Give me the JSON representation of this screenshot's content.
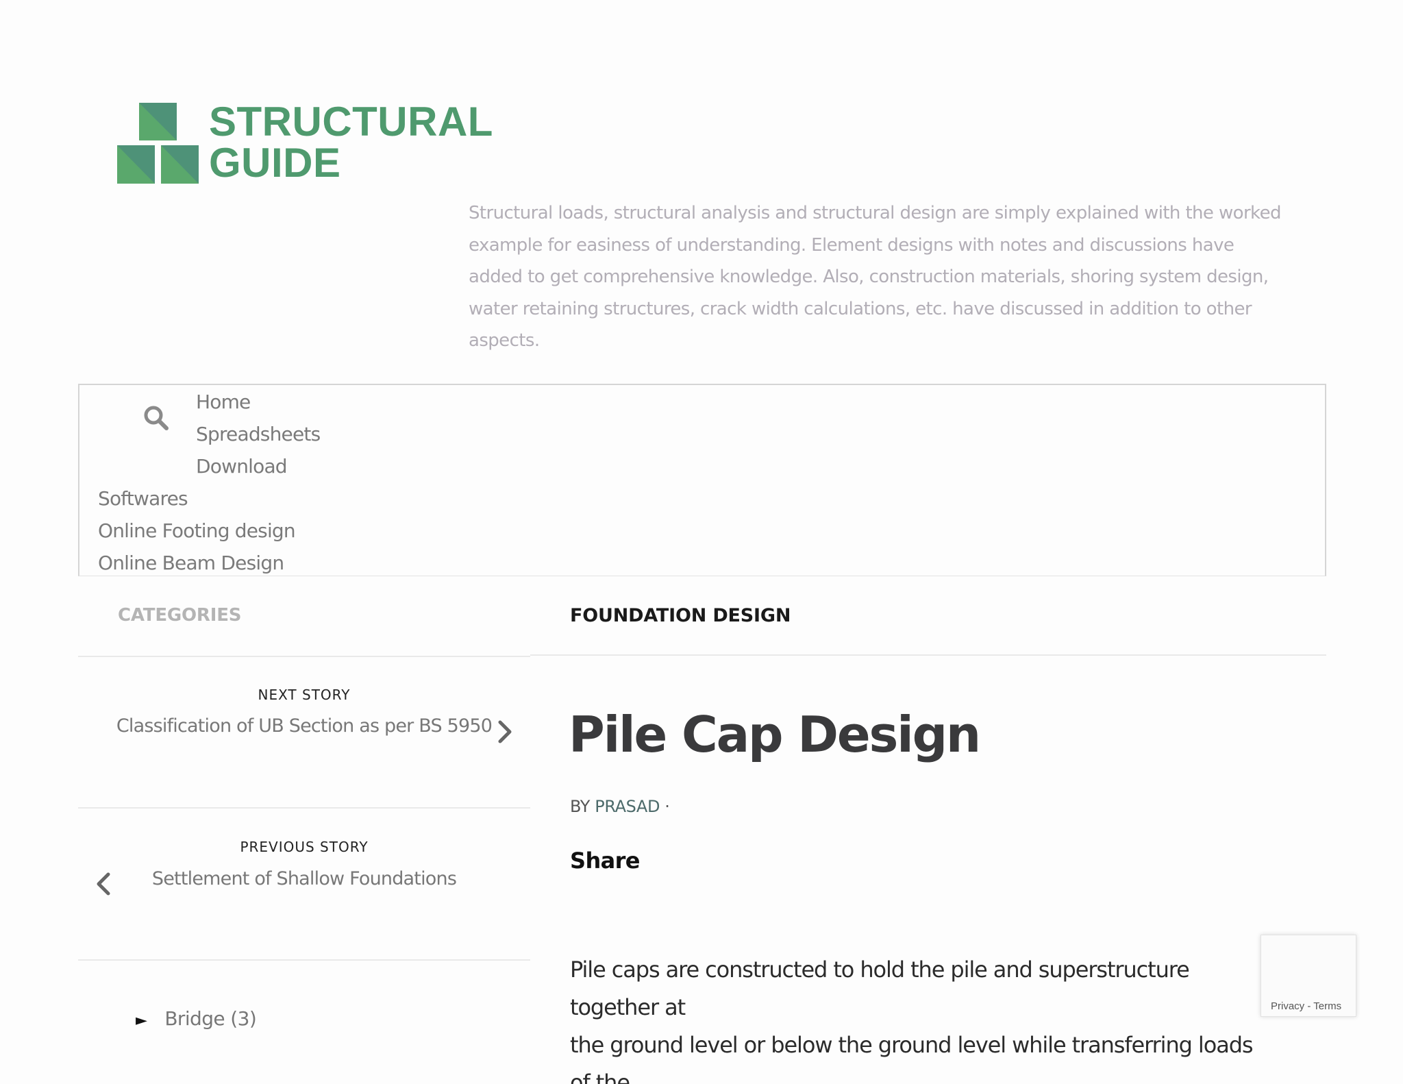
{
  "site": {
    "logo_line1": "STRUCTURAL",
    "logo_line2": "GUIDE",
    "brand_color": "#4f9a6e",
    "tagline": "Structural loads, structural analysis and structural design are simply explained with the worked example for easiness of understanding. Element designs with notes and discussions have added to get comprehensive knowledge. Also, construction materials, shoring system design, water retaining structures, crack width calculations, etc. have discussed in addition to other aspects."
  },
  "nav": {
    "items": [
      "Home",
      "Spreadsheets",
      "Download",
      "Softwares",
      "Online Footing design",
      "Online Beam Design"
    ]
  },
  "sidebar": {
    "categories_label": "CATEGORIES",
    "next_kicker": "NEXT STORY",
    "next_title": "Classification of UB Section as per BS 5950",
    "prev_kicker": "PREVIOUS STORY",
    "prev_title": "Settlement of Shallow Foundations",
    "category_arrow": "►",
    "category_item": "Bridge (3)"
  },
  "article": {
    "section": "FOUNDATION DESIGN",
    "title": "Pile Cap Design",
    "by_prefix": "BY ",
    "author": "PRASAD",
    "by_suffix": " ·",
    "share_label": "Share",
    "body_line1": "Pile caps are constructed to hold the pile and superstructure together at",
    "body_line2": "the ground level or below the ground level while transferring loads of the"
  },
  "recaptcha": {
    "text": "Privacy - Terms"
  }
}
